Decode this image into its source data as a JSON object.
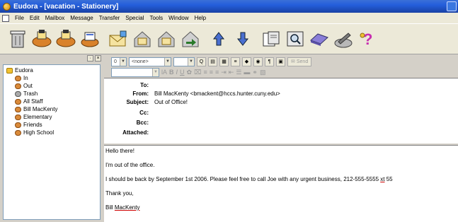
{
  "window": {
    "title": "Eudora - [vacation - Stationery]"
  },
  "menu": [
    "File",
    "Edit",
    "Mailbox",
    "Message",
    "Transfer",
    "Special",
    "Tools",
    "Window",
    "Help"
  ],
  "toolbar": {
    "buttons": [
      "trash-icon",
      "check-mail-icon",
      "send-queued-icon",
      "address-book-icon",
      "new-message-icon",
      "reply-icon",
      "reply-all-icon",
      "forward-icon",
      "previous-message-icon",
      "next-message-icon",
      "attach-icon",
      "find-icon",
      "filter-icon",
      "options-icon",
      "help-icon"
    ]
  },
  "mailboxes": {
    "root": "Eudora",
    "items": [
      "In",
      "Out",
      "Trash",
      "All Staff",
      "Bill MacKenty",
      "Elementary",
      "Friends",
      "High School"
    ]
  },
  "format_bar": {
    "priority": "0",
    "signature": "<none>",
    "send_label": "Send"
  },
  "headers": {
    "to_label": "To:",
    "from_label": "From:",
    "from_value": "Bill MacKenty <bmackent@hccs.hunter.cuny.edu>",
    "subject_label": "Subject:",
    "subject_value": "Out of Office!",
    "cc_label": "Cc:",
    "bcc_label": "Bcc:",
    "attached_label": "Attached:"
  },
  "body": {
    "greeting": "Hello there!",
    "line1": "I'm out of the office.",
    "line2_pre": "I should be back by September 1st 2006. Please feel free to call Joe with any urgent business, 212-555-5555 ",
    "line2_ext": "xt",
    "line2_post": " 55",
    "thanks": "Thank you,",
    "sig_first": "Bill ",
    "sig_last": "MacKenty"
  },
  "colors": {
    "title_bar": "#245edb",
    "chrome": "#d4d0c8",
    "tree_border": "#7f9db9"
  }
}
